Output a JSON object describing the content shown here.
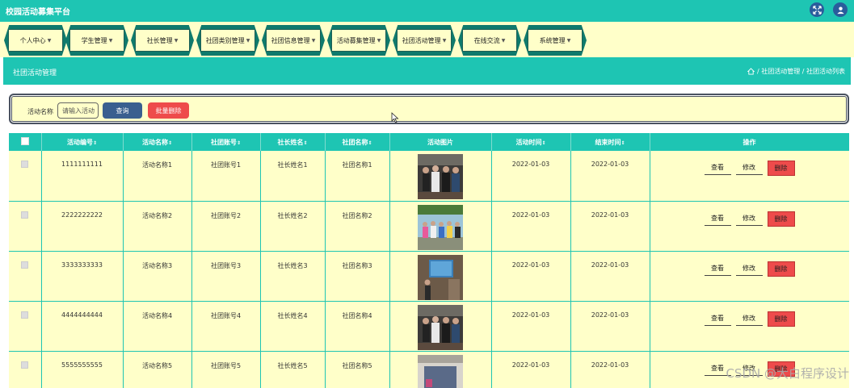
{
  "app": {
    "title": "校园活动募集平台"
  },
  "nav": {
    "items": [
      {
        "label": "个人中心"
      },
      {
        "label": "学生管理"
      },
      {
        "label": "社长管理"
      },
      {
        "label": "社团类别管理"
      },
      {
        "label": "社团信息管理"
      },
      {
        "label": "活动募集管理"
      },
      {
        "label": "社团活动管理"
      },
      {
        "label": "在线交流"
      },
      {
        "label": "系统管理"
      }
    ]
  },
  "breadcrumb": {
    "title": "社团活动管理",
    "path": "/ 社团活动管理 / 社团活动列表"
  },
  "search": {
    "label": "活动名称",
    "placeholder": "请输入活动",
    "query_label": "查询",
    "batch_delete_label": "批量删除"
  },
  "table": {
    "headers": [
      "活动编号",
      "活动名称",
      "社团账号",
      "社长姓名",
      "社团名称",
      "活动图片",
      "活动时间",
      "结束时间",
      "操作"
    ],
    "sort_glyph": "⇕",
    "rows": [
      {
        "id": "1111111111",
        "name": "活动名称1",
        "account": "社团账号1",
        "leader": "社长姓名1",
        "club": "社团名称1",
        "start": "2022-01-03",
        "end": "2022-01-03",
        "photo": "group-photo"
      },
      {
        "id": "2222222222",
        "name": "活动名称2",
        "account": "社团账号2",
        "leader": "社长姓名2",
        "club": "社团名称2",
        "start": "2022-01-03",
        "end": "2022-01-03",
        "photo": "outdoor-photo"
      },
      {
        "id": "3333333333",
        "name": "活动名称3",
        "account": "社团账号3",
        "leader": "社长姓名3",
        "club": "社团名称3",
        "start": "2022-01-03",
        "end": "2022-01-03",
        "photo": "screen-photo"
      },
      {
        "id": "4444444444",
        "name": "活动名称4",
        "account": "社团账号4",
        "leader": "社长姓名4",
        "club": "社团名称4",
        "start": "2022-01-03",
        "end": "2022-01-03",
        "photo": "group-photo"
      },
      {
        "id": "5555555555",
        "name": "活动名称5",
        "account": "社团账号5",
        "leader": "社长姓名5",
        "club": "社团名称5",
        "start": "2022-01-03",
        "end": "2022-01-03",
        "photo": "room-photo"
      }
    ],
    "actions": {
      "view": "查看",
      "edit": "修改",
      "delete": "删除"
    }
  },
  "watermark": "CSDN @大白程序设计",
  "colors": {
    "primary": "#1ec5b3",
    "panel": "#ffffc9",
    "danger": "#ee4b4b",
    "button": "#3a5f8f",
    "icon": "#2a5c9c"
  },
  "icons": [
    "fullscreen-icon",
    "user-icon",
    "home-icon",
    "cursor-icon"
  ]
}
